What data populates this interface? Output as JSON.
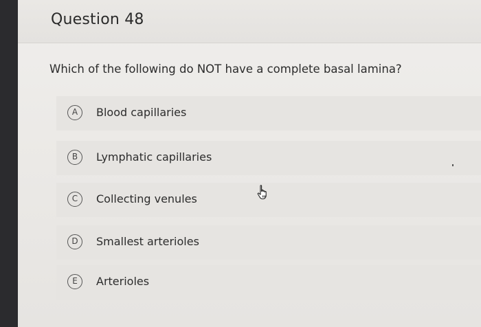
{
  "question": {
    "title": "Question 48",
    "text": "Which of the following do NOT have a complete basal lamina?"
  },
  "options": [
    {
      "letter": "A",
      "label": "Blood capillaries"
    },
    {
      "letter": "B",
      "label": "Lymphatic capillaries"
    },
    {
      "letter": "C",
      "label": "Collecting venules"
    },
    {
      "letter": "D",
      "label": "Smallest arterioles"
    },
    {
      "letter": "E",
      "label": "Arterioles"
    }
  ],
  "cursor": {
    "icon": "hand-pointer-icon"
  }
}
